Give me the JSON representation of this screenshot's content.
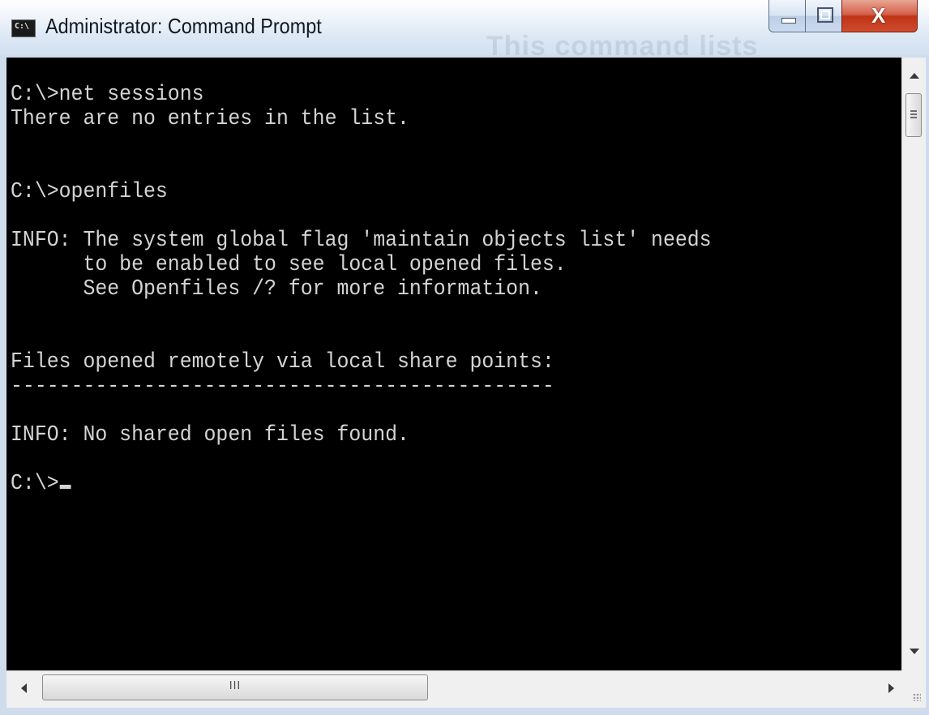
{
  "window": {
    "title": "Administrator: Command Prompt",
    "icon_label": "C:\\",
    "background_ghost_text": "This command lists"
  },
  "caption_buttons": {
    "minimize_icon": "minimize-icon",
    "maximize_icon": "maximize-icon",
    "close_glyph": "X"
  },
  "console": {
    "lines": [
      "C:\\>net sessions",
      "There are no entries in the list.",
      "",
      "",
      "C:\\>openfiles",
      "",
      "INFO: The system global flag 'maintain objects list' needs",
      "      to be enabled to see local opened files.",
      "      See Openfiles /? for more information.",
      "",
      "",
      "Files opened remotely via local share points:",
      "---------------------------------------------",
      "",
      "INFO: No shared open files found.",
      "",
      "C:\\>"
    ],
    "colors": {
      "background": "#000000",
      "text": "#d4d4d4"
    }
  },
  "scrollbars": {
    "horizontal_grip": "III"
  }
}
